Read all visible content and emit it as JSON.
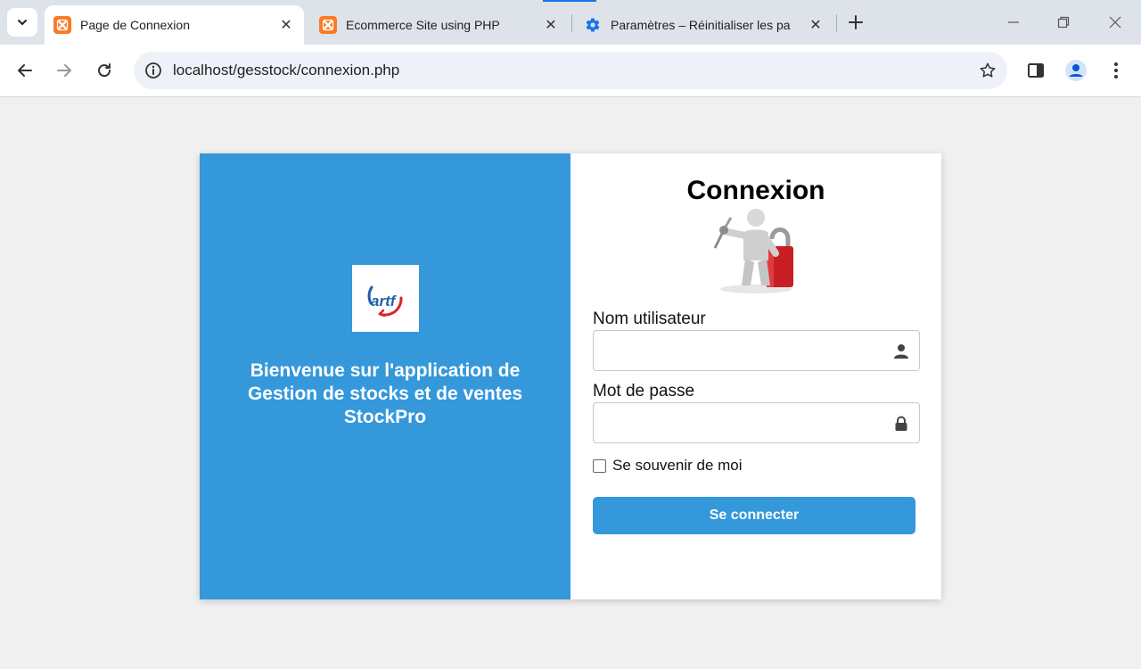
{
  "browser": {
    "tabs": [
      {
        "title": "Page de Connexion",
        "active": true,
        "icon": "xampp-icon"
      },
      {
        "title": "Ecommerce Site using PHP",
        "active": false,
        "icon": "xampp-icon"
      },
      {
        "title": "Paramètres – Réinitialiser les pa",
        "active": false,
        "icon": "gear-icon"
      }
    ],
    "close_glyph": "✕",
    "url": "localhost/gesstock/connexion.php"
  },
  "page": {
    "logo_alt": "artf",
    "welcome_line1": "Bienvenue sur l'application de",
    "welcome_line2": "Gestion de stocks et de ventes",
    "welcome_line3": "StockPro",
    "form_title": "Connexion",
    "username_label": "Nom utilisateur",
    "username_value": "",
    "password_label": "Mot de passe",
    "password_value": "",
    "remember_label": "Se souvenir de moi",
    "remember_checked": false,
    "submit_label": "Se connecter"
  },
  "colors": {
    "primary": "#3498db",
    "tabstrip": "#dee3ea",
    "omnibox": "#eef1f8",
    "page_bg": "#f0f0f0",
    "xampp_orange": "#fb7a24"
  }
}
